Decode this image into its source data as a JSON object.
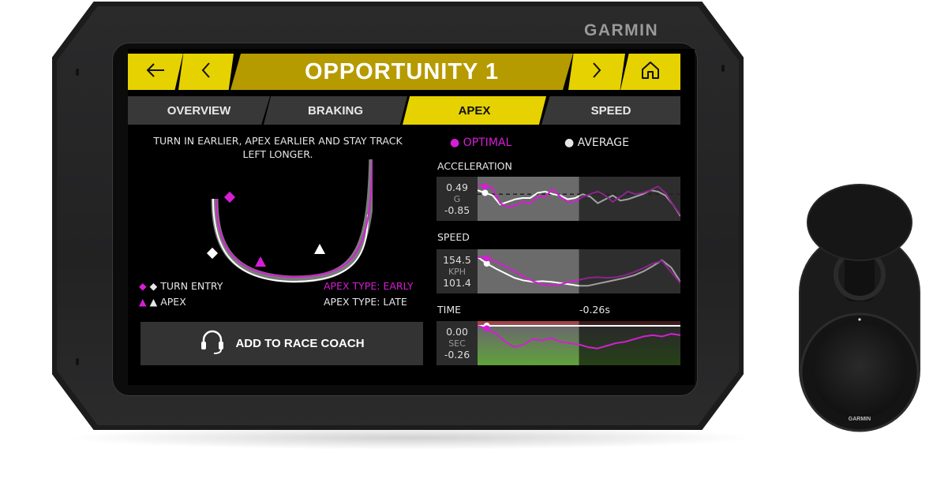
{
  "device": {
    "brand": "GARMIN",
    "camera_brand": "GARMIN"
  },
  "header": {
    "back_icon": "arrow-left-icon",
    "prev_icon": "chevron-left-icon",
    "title": "OPPORTUNITY 1",
    "next_icon": "chevron-right-icon",
    "home_icon": "home-icon"
  },
  "tabs": [
    {
      "label": "OVERVIEW",
      "active": false
    },
    {
      "label": "BRAKING",
      "active": false
    },
    {
      "label": "APEX",
      "active": true
    },
    {
      "label": "SPEED",
      "active": false
    }
  ],
  "apex": {
    "hint": "TURN IN EARLIER, APEX EARLIER AND STAY TRACK LEFT LONGER.",
    "legend": {
      "turn_entry": "TURN ENTRY",
      "apex": "APEX"
    },
    "apex_type_optimal": "APEX TYPE: EARLY",
    "apex_type_average": "APEX TYPE: LATE"
  },
  "coach_button": {
    "label": "ADD TO RACE COACH",
    "icon": "headset-icon"
  },
  "colors": {
    "accent_yellow": "#e6d200",
    "title_gold": "#b59a00",
    "optimal": "#d51ed5",
    "average": "#ffffff"
  },
  "chart_data": [
    {
      "type": "line",
      "title": "ACCELERATION",
      "unit": "G",
      "ylim": [
        -0.85,
        0.49
      ],
      "y_max_label": "0.49",
      "y_min_label": "-0.85",
      "reference_line": 0,
      "legend": [
        "OPTIMAL",
        "AVERAGE"
      ],
      "highlight_fraction": 0.5,
      "series": [
        {
          "name": "OPTIMAL",
          "values": [
            0.35,
            0.3,
            0.25,
            -0.35,
            -0.5,
            -0.45,
            -0.3,
            -0.35,
            -0.1,
            -0.1,
            0.2,
            -0.1,
            -0.3,
            -0.3,
            -0.1,
            0.0,
            0.1,
            -0.05,
            -0.3,
            -0.1,
            0.1,
            0.0,
            0.05,
            0.15,
            0.3,
            0.05,
            -0.4,
            -0.8
          ]
        },
        {
          "name": "AVERAGE",
          "values": [
            0.15,
            0.05,
            -0.05,
            -0.4,
            -0.3,
            -0.2,
            -0.15,
            -0.15,
            0.05,
            0.1,
            0.0,
            -0.05,
            -0.2,
            -0.15,
            0.0,
            -0.1,
            -0.35,
            -0.2,
            -0.05,
            -0.25,
            -0.2,
            -0.1,
            0.0,
            0.15,
            0.1,
            -0.05,
            -0.4,
            -0.85
          ]
        }
      ]
    },
    {
      "type": "line",
      "title": "SPEED",
      "unit": "KPH",
      "ylim": [
        101.4,
        154.5
      ],
      "y_max_label": "154.5",
      "y_min_label": "101.4",
      "highlight_fraction": 0.5,
      "series": [
        {
          "name": "OPTIMAL",
          "values": [
            150,
            148,
            143,
            136,
            128,
            120,
            113,
            108,
            106,
            108,
            112,
            115,
            118,
            119,
            118,
            119,
            122,
            127,
            133,
            140,
            144,
            127,
            110
          ]
        },
        {
          "name": "AVERAGE",
          "values": [
            150,
            140,
            132,
            125,
            118,
            114,
            112,
            113,
            112,
            110,
            108,
            106,
            106,
            109,
            112,
            115,
            118,
            122,
            128,
            136,
            145,
            134,
            112
          ]
        }
      ]
    },
    {
      "type": "line",
      "title": "TIME",
      "unit": "SEC",
      "ylim": [
        -0.26,
        0.0
      ],
      "y_max_label": "0.00",
      "y_min_label": "-0.26",
      "delta_label": "-0.26s",
      "highlight_fraction": 0.5,
      "series": [
        {
          "name": "OPTIMAL",
          "values": [
            0.0,
            -0.02,
            -0.06,
            -0.12,
            -0.16,
            -0.14,
            -0.1,
            -0.11,
            -0.09,
            -0.12,
            -0.13,
            -0.14,
            -0.16,
            -0.17,
            -0.15,
            -0.13,
            -0.12,
            -0.1,
            -0.08,
            -0.07,
            -0.08,
            -0.06,
            -0.07
          ]
        },
        {
          "name": "AVERAGE",
          "values": [
            0.0,
            0.0,
            0.0,
            0.0,
            0.0,
            0.0,
            0.0,
            0.0,
            0.0,
            0.0,
            0.0,
            0.0,
            0.0,
            0.0,
            0.0,
            0.0,
            0.0,
            0.0,
            0.0,
            0.0,
            0.0,
            0.0,
            0.0
          ]
        }
      ]
    }
  ]
}
